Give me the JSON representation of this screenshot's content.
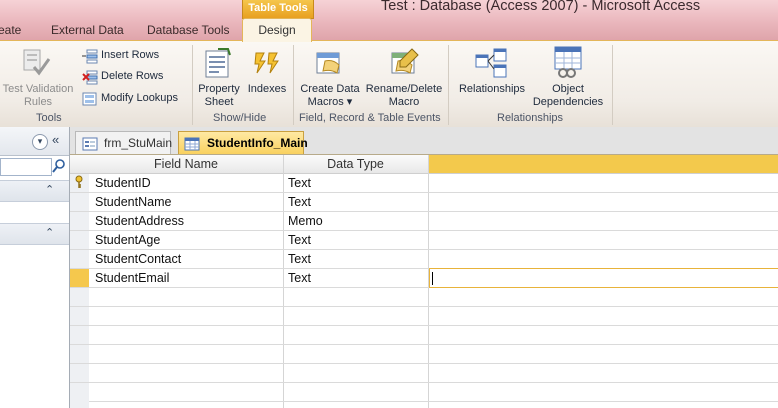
{
  "window": {
    "title": "Test : Database (Access 2007)  -  Microsoft Access"
  },
  "ribbon": {
    "context_tab": "Table Tools",
    "tabs": [
      {
        "label": "eate"
      },
      {
        "label": "External Data"
      },
      {
        "label": "Database Tools"
      },
      {
        "label": "Design",
        "active": true
      }
    ],
    "tools": {
      "group_label": "Tools",
      "test_validation": {
        "line1": "Test Validation",
        "line2": "Rules"
      },
      "insert_rows": "Insert Rows",
      "delete_rows": "Delete Rows",
      "modify_lookups": "Modify Lookups"
    },
    "show_hide": {
      "group_label": "Show/Hide",
      "property_sheet": {
        "line1": "Property",
        "line2": "Sheet"
      },
      "indexes": "Indexes"
    },
    "field_events": {
      "group_label": "Field, Record & Table Events",
      "create_data_macros": {
        "line1": "Create Data",
        "line2": "Macros ▾"
      },
      "rename_delete_macro": {
        "line1": "Rename/Delete",
        "line2": "Macro"
      }
    },
    "relationships": {
      "group_label": "Relationships",
      "relationships_btn": "Relationships",
      "object_dependencies": {
        "line1": "Object",
        "line2": "Dependencies"
      }
    }
  },
  "nav_pane": {
    "menu_icon": "chevron-down-icon",
    "collapse_icon": "double-chevron-left-icon",
    "search_placeholder": "",
    "group_collapse_icon": "double-chevron-up-icon"
  },
  "doc_tabs": [
    {
      "label": "frm_StuMain",
      "icon": "form-icon",
      "active": false
    },
    {
      "label": "StudentInfo_Main",
      "icon": "table-icon",
      "active": true
    }
  ],
  "table_design": {
    "columns": [
      "Field Name",
      "Data Type",
      ""
    ],
    "rows": [
      {
        "field": "StudentID",
        "type": "Text",
        "primary_key": true
      },
      {
        "field": "StudentName",
        "type": "Text"
      },
      {
        "field": "StudentAddress",
        "type": "Memo"
      },
      {
        "field": "StudentAge",
        "type": "Text"
      },
      {
        "field": "StudentContact",
        "type": "Text"
      },
      {
        "field": "StudentEmail",
        "type": "Text",
        "selected": true
      }
    ]
  },
  "colors": {
    "accent_gold": "#f9d15f",
    "ribbon_border": "#e4b65a",
    "title_pink": "#eab7bd",
    "selection_border": "#e8b33a"
  }
}
